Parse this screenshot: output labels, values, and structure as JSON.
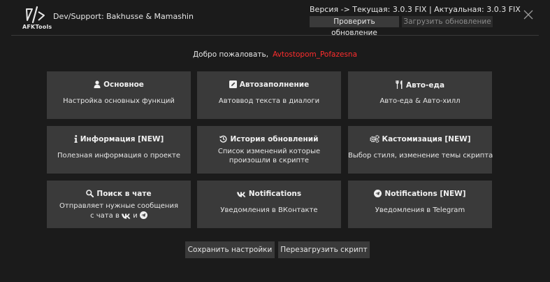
{
  "header": {
    "logo_text": "AFKTools",
    "dev_support": "Dev/Support: Bakhusse & Mamashin",
    "version": "Версия -> Текущая: 3.0.3 FIX | Актуальная: 3.0.3 FIX",
    "check_update": "Проверить обновление",
    "download_update": "Загрузить обновление"
  },
  "welcome": {
    "text": "Добро пожаловать,",
    "user": "Avtostopom_Pofazesna",
    "user_color": "#ff2d2d"
  },
  "tiles": [
    {
      "title": "Основное",
      "icon": "user-icon",
      "desc": "Настройка основных функций"
    },
    {
      "title": "Автозаполнение",
      "icon": "edit-icon",
      "desc": "Автоввод текста в диалоги"
    },
    {
      "title": "Авто-еда",
      "icon": "utensils-icon",
      "desc": "Авто-еда & Авто-хилл"
    },
    {
      "title": "Информация [NEW]",
      "icon": "info-icon",
      "desc": "Полезная информация о проекте"
    },
    {
      "title": "История обновлений",
      "icon": "history-icon",
      "desc_line1": "Список изменений которые",
      "desc_line2": "произошли в скрипте"
    },
    {
      "title": "Кастомизация [NEW]",
      "icon": "gears-icon",
      "desc": "Выбор стиля, изменение темы скрипта"
    },
    {
      "title": "Поиск в чате",
      "icon": "search-icon",
      "desc_line1": "Отправляет нужные сообщения",
      "desc_line2a": "с чата в",
      "desc_line2b": "и"
    },
    {
      "title": "Notifications",
      "icon": "vk-icon",
      "desc": "Уведомления в ВКонтакте"
    },
    {
      "title": "Notifications [NEW]",
      "icon": "telegram-icon",
      "desc": "Уведомления в Telegram"
    }
  ],
  "footer": {
    "save": "Сохранить настройки",
    "reload": "Перезагрузить скрипт"
  },
  "colors": {
    "background": "#1b1b1b",
    "tile": "#3a3a3a",
    "accent_user": "#ff2d2d"
  }
}
